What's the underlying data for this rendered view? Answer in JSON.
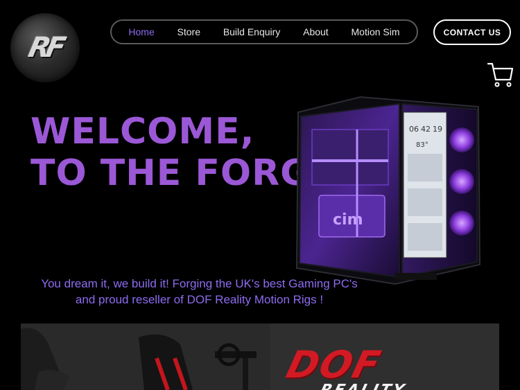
{
  "logo": {
    "text": "RF"
  },
  "nav": {
    "items": [
      {
        "label": "Home",
        "active": true
      },
      {
        "label": "Store",
        "active": false
      },
      {
        "label": "Build Enquiry",
        "active": false
      },
      {
        "label": "About",
        "active": false
      },
      {
        "label": "Motion Sim",
        "active": false
      }
    ]
  },
  "contact_button": {
    "label": "CONTACT US"
  },
  "cart": {
    "icon": "cart-icon"
  },
  "hero": {
    "line1": "WELCOME,",
    "line2": "TO THE FORGE."
  },
  "tagline": {
    "line1": "You dream it, we build it! Forging the UK's best Gaming PC's",
    "line2": "and proud reseller of DOF Reality Motion Rigs !"
  },
  "pc_display": {
    "time": [
      "06",
      "42",
      "19"
    ],
    "temp": "83°"
  },
  "banner": {
    "brand": "DOF",
    "brand_sub": "REALITY"
  },
  "colors": {
    "accent": "#9b58d6",
    "nav_active": "#8d6cf0",
    "brand_red": "#d21a24",
    "background": "#000000"
  }
}
